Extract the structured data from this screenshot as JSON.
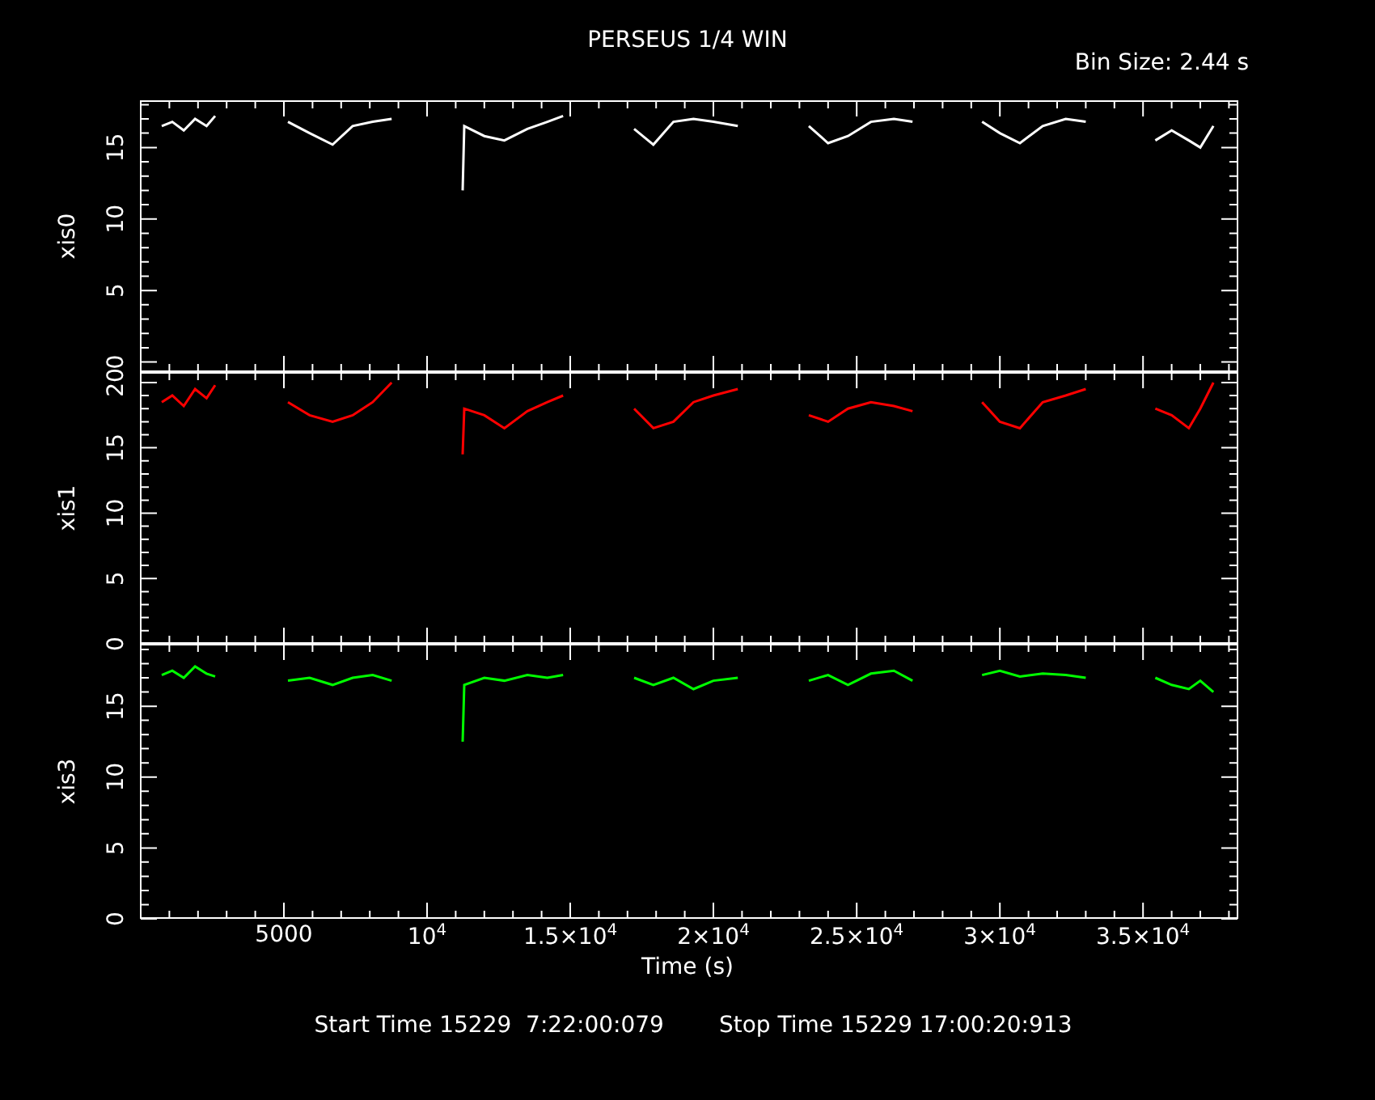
{
  "title": "PERSEUS 1/4 WIN",
  "bin_size": "Bin Size: 2.44 s",
  "panels": [
    {
      "chart_data": {
        "type": "line",
        "ylabel": "xis0",
        "xlim": [
          0,
          38300
        ],
        "ylim": [
          -0.7,
          18.3
        ],
        "yticks": [
          0,
          5,
          10,
          15
        ],
        "x": [
          735,
          1100,
          1500,
          1900,
          2300,
          2600,
          5140,
          5900,
          6700,
          7400,
          8100,
          8760,
          11240,
          11300,
          12000,
          12700,
          13500,
          14200,
          14750,
          17230,
          17900,
          18600,
          19300,
          20000,
          20850,
          23330,
          24000,
          24700,
          25500,
          26300,
          26950,
          29380,
          30000,
          30700,
          31500,
          32300,
          33000,
          35430,
          36000,
          36600,
          37000,
          37460
        ],
        "series": [
          {
            "color": "#ffffff",
            "values": [
              16.5,
              16.8,
              16.2,
              17,
              16.5,
              17.2,
              16.8,
              16,
              15.2,
              16.5,
              16.8,
              17,
              12,
              16.5,
              15.8,
              15.5,
              16.3,
              16.8,
              17.2,
              16.3,
              15.2,
              16.8,
              17,
              16.8,
              16.5,
              16.5,
              15.3,
              15.8,
              16.8,
              17,
              16.8,
              16.8,
              16,
              15.3,
              16.5,
              17,
              16.8,
              15.5,
              16.2,
              15.5,
              15,
              16.5
            ]
          }
        ]
      }
    },
    {
      "chart_data": {
        "type": "line",
        "ylabel": "xis1",
        "xlim": [
          0,
          38300
        ],
        "ylim": [
          0,
          20.8
        ],
        "yticks": [
          0,
          5,
          10,
          15,
          20
        ],
        "x": [
          735,
          1100,
          1500,
          1900,
          2300,
          2600,
          5140,
          5900,
          6700,
          7400,
          8100,
          8760,
          11240,
          11300,
          12000,
          12700,
          13500,
          14200,
          14750,
          17230,
          17900,
          18600,
          19300,
          20000,
          20850,
          23330,
          24000,
          24700,
          25500,
          26300,
          26950,
          29380,
          30000,
          30700,
          31500,
          32300,
          33000,
          35430,
          36000,
          36600,
          37000,
          37460
        ],
        "series": [
          {
            "color": "#ff0000",
            "values": [
              18.5,
              19,
              18.2,
              19.5,
              18.8,
              19.8,
              18.5,
              17.5,
              17,
              17.5,
              18.5,
              20,
              14.5,
              18,
              17.5,
              16.5,
              17.8,
              18.5,
              19,
              18,
              16.5,
              17,
              18.5,
              19,
              19.5,
              17.5,
              17,
              18,
              18.5,
              18.2,
              17.8,
              18.5,
              17,
              16.5,
              18.5,
              19,
              19.5,
              18,
              17.5,
              16.5,
              18,
              20
            ]
          }
        ]
      }
    },
    {
      "chart_data": {
        "type": "line",
        "ylabel": "xis3",
        "xlabel": "Time (s)",
        "xlim": [
          0,
          38300
        ],
        "ylim": [
          0,
          19.4
        ],
        "xticks": [
          5000,
          {
            "value": 10000,
            "label": "10$^{4}$"
          },
          {
            "value": 15000,
            "label": "1.5×10$^{4}$"
          },
          {
            "value": 20000,
            "label": "2×10$^{4}$"
          },
          {
            "value": 25000,
            "label": "2.5×10$^{4}$"
          },
          {
            "value": 30000,
            "label": "3×10$^{4}$"
          },
          {
            "value": 35000,
            "label": "3.5×10$^{4}$"
          }
        ],
        "yticks": [
          0,
          5,
          10,
          15
        ],
        "x": [
          735,
          1100,
          1500,
          1900,
          2300,
          2600,
          5140,
          5900,
          6700,
          7400,
          8100,
          8760,
          11240,
          11300,
          12000,
          12700,
          13500,
          14200,
          14750,
          17230,
          17900,
          18600,
          19300,
          20000,
          20850,
          23330,
          24000,
          24700,
          25500,
          26300,
          26950,
          29380,
          30000,
          30700,
          31500,
          32300,
          33000,
          35430,
          36000,
          36600,
          37000,
          37460
        ],
        "series": [
          {
            "color": "#00ff00",
            "values": [
              17.2,
              17.5,
              17,
              17.8,
              17.3,
              17.1,
              16.8,
              17,
              16.5,
              17,
              17.2,
              16.8,
              12.5,
              16.5,
              17,
              16.8,
              17.2,
              17,
              17.2,
              17,
              16.5,
              17,
              16.2,
              16.8,
              17,
              16.8,
              17.2,
              16.5,
              17.3,
              17.5,
              16.8,
              17.2,
              17.5,
              17.1,
              17.3,
              17.2,
              17,
              17,
              16.5,
              16.2,
              16.8,
              16
            ]
          }
        ]
      }
    }
  ],
  "start_time": "Start Time 15229  7:22:00:079",
  "stop_time": "Stop Time 15229 17:00:20:913"
}
